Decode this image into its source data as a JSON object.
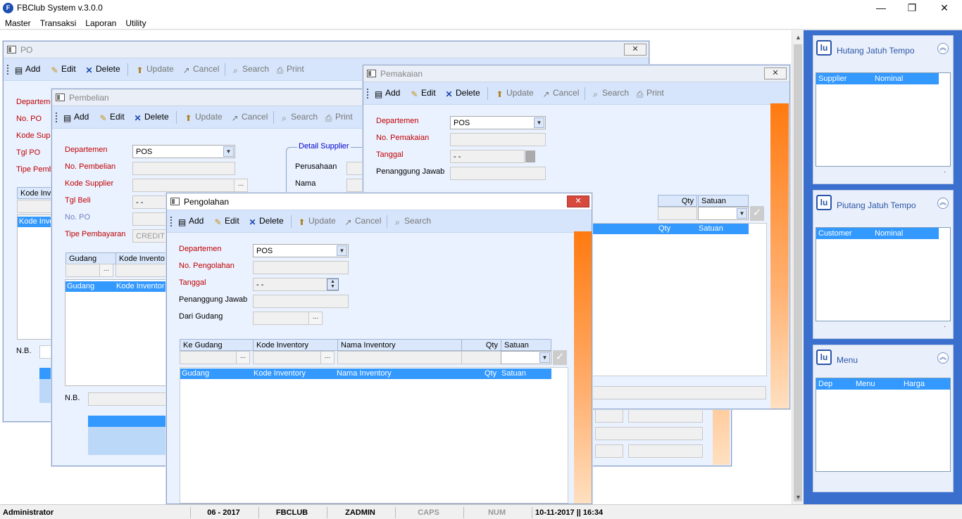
{
  "app": {
    "title": "FBClub System v.3.0.0",
    "icon_label": "F",
    "controls": {
      "minimize": "—",
      "restore": "❐",
      "close": "✕"
    }
  },
  "menubar": [
    "Master",
    "Transaksi",
    "Laporan",
    "Utility"
  ],
  "toolbar_labels": {
    "add": "Add",
    "edit": "Edit",
    "delete": "Delete",
    "update": "Update",
    "cancel": "Cancel",
    "search": "Search",
    "print": "Print"
  },
  "windows": {
    "po": {
      "title": "PO",
      "close": "✕",
      "labels": [
        "Departeme",
        "No. PO",
        "Kode Supp",
        "Tgl PO",
        "Tipe Pemba"
      ],
      "grid_header": "Kode Inve",
      "grid_selected": "Kode Inve",
      "nb": "N.B."
    },
    "pembelian": {
      "title": "Pembelian",
      "departemen_label": "Departemen",
      "departemen_value": "POS",
      "no_pembelian_label": "No. Pembelian",
      "kode_supplier_label": "Kode Supplier",
      "tgl_beli_label": "Tgl Beli",
      "tgl_beli_value": "- -",
      "no_po_label": "No. PO",
      "tipe_pembayaran_label": "Tipe Pembayaran",
      "tipe_pembayaran_value": "CREDIT",
      "detail_supplier": "Detail Supplier",
      "perusahaan_label": "Perusahaan",
      "nama_label": "Nama",
      "grid_headers": [
        "Gudang",
        "Kode Invento"
      ],
      "grid_selected": [
        "Gudang",
        "Kode Inventor"
      ],
      "nb": "N.B.",
      "ellipsis": "..."
    },
    "pemakaian": {
      "title": "Pemakaian",
      "close": "✕",
      "departemen_label": "Departemen",
      "departemen_value": "POS",
      "no_pemakaian_label": "No. Pemakaian",
      "tanggal_label": "Tanggal",
      "tanggal_value": "- -",
      "penanggung_label": "Penanggung Jawab",
      "grid_headers": [
        "Qty",
        "Satuan"
      ],
      "grid_selected": [
        "Qty",
        "Satuan"
      ]
    },
    "pengolahan": {
      "title": "Pengolahan",
      "close": "✕",
      "departemen_label": "Departemen",
      "departemen_value": "POS",
      "no_pengolahan_label": "No. Pengolahan",
      "tanggal_label": "Tanggal",
      "tanggal_value": "- -",
      "penanggung_label": "Penanggung Jawab",
      "dari_gudang_label": "Dari Gudang",
      "grid_headers": [
        "Ke Gudang",
        "Kode Inventory",
        "Nama Inventory",
        "Qty",
        "Satuan"
      ],
      "grid_selected": [
        "Gudang",
        "Kode Inventory",
        "Nama Inventory",
        "Qty",
        "Satuan"
      ],
      "ellipsis": "...",
      "check": "✓"
    }
  },
  "right_panel": {
    "hutang": {
      "title": "Hutang Jatuh Tempo",
      "columns": [
        "Supplier",
        "Nominal"
      ],
      "footer": "."
    },
    "piutang": {
      "title": "Piutang Jatuh Tempo",
      "columns": [
        "Customer",
        "Nominal"
      ],
      "footer": "."
    },
    "menu": {
      "title": "Menu",
      "columns": [
        "Dep",
        "Menu",
        "Harga"
      ]
    },
    "chevron": "︽",
    "icon_label": "lu"
  },
  "statusbar": {
    "user": "Administrator",
    "period": "06 - 2017",
    "company": "FBCLUB",
    "login": "ZADMIN",
    "caps": "CAPS",
    "num": "NUM",
    "datetime": "10-11-2017 || 16:34"
  },
  "colors": {
    "accent": "#3399ff",
    "panel": "#3a6fcd",
    "window_bg": "#eaf2ff",
    "toolbar": "#d6e5fb",
    "required_label": "#c00000",
    "orange": "#ff7a10"
  }
}
